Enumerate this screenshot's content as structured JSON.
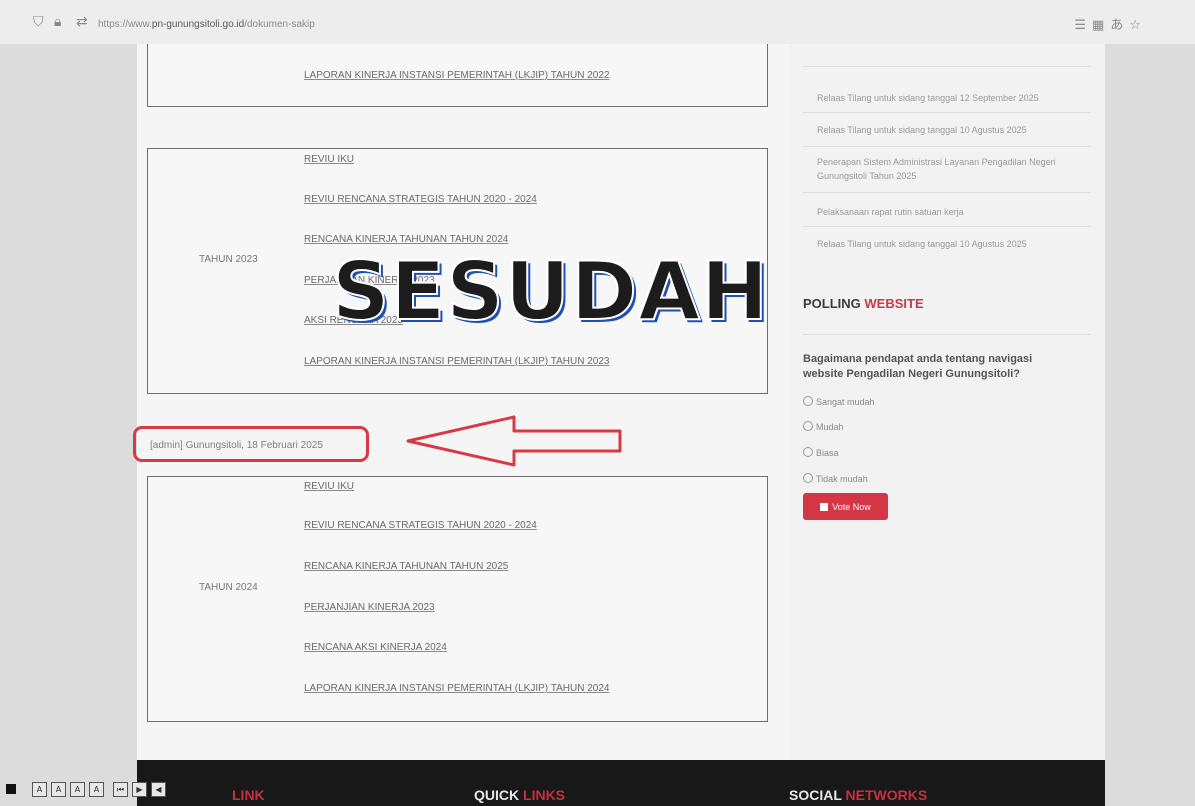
{
  "browser": {
    "url_prefix": "https://www.",
    "url_domain": "pn-gunungsitoli.go.id",
    "url_path": "/dokumen-sakip",
    "icons": [
      "reader-icon",
      "grid-icon",
      "translate-icon",
      "star-icon"
    ]
  },
  "docs": {
    "top_box": {
      "links": [
        "LAPORAN KINERJA INSTANSI PEMERINTAH (LKJIP) TAHUN 2022"
      ]
    },
    "box_2023": {
      "year": "TAHUN 2023",
      "links": [
        "REVIU IKU",
        "REVIU RENCANA STRATEGIS TAHUN 2020 - 2024",
        "RENCANA KINERJA TAHUNAN TAHUN 2024",
        "PERJANJIAN KINERJA 2023",
        "AKSI RENCANA 2023",
        "LAPORAN KINERJA INSTANSI PEMERINTAH (LKJIP) TAHUN 2023"
      ]
    },
    "edited_note": "[admin] Gunungsitoli, 18 Februari 2025",
    "box_2024": {
      "year": "TAHUN 2024",
      "links": [
        "REVIU IKU",
        "REVIU RENCANA STRATEGIS TAHUN 2020 - 2024",
        "RENCANA KINERJA TAHUNAN TAHUN 2025",
        "PERJANJIAN KINERJA 2023",
        "RENCANA AKSI KINERJA 2024",
        "LAPORAN KINERJA INSTANSI PEMERINTAH (LKJIP) TAHUN 2024"
      ]
    }
  },
  "watermark": "SESUDAH",
  "sidebar": {
    "news": [
      "Relaas Tilang untuk sidang tanggal 12 September 2025",
      "Relaas Tilang untuk sidang tanggal 10 Agustus 2025",
      "Penerapan Sistem Administrasi Layanan Pengadilan Negeri Gunungsitoli Tahun 2025",
      "Pelaksanaan rapat rutin satuan kerja",
      "Relaas Tilang untuk sidang tanggal 10 Agustus 2025"
    ],
    "poll": {
      "title_main": "POLLING",
      "title_accent": "WEBSITE",
      "question": "Bagaimana pendapat anda tentang navigasi website Pengadilan Negeri Gunungsitoli?",
      "options": [
        "Sangat mudah",
        "Mudah",
        "Biasa",
        "Tidak mudah"
      ],
      "vote_label": "Vote Now"
    }
  },
  "footer": {
    "col1_accent": "LINK",
    "col2_main": "QUICK",
    "col2_accent": "LINKS",
    "col3_main": "SOCIAL",
    "col3_accent": "NETWORKS"
  },
  "colors": {
    "accent_red": "#d33645",
    "watermark_shadow": "#1e4fb5",
    "annotation_red": "#d83a45"
  }
}
